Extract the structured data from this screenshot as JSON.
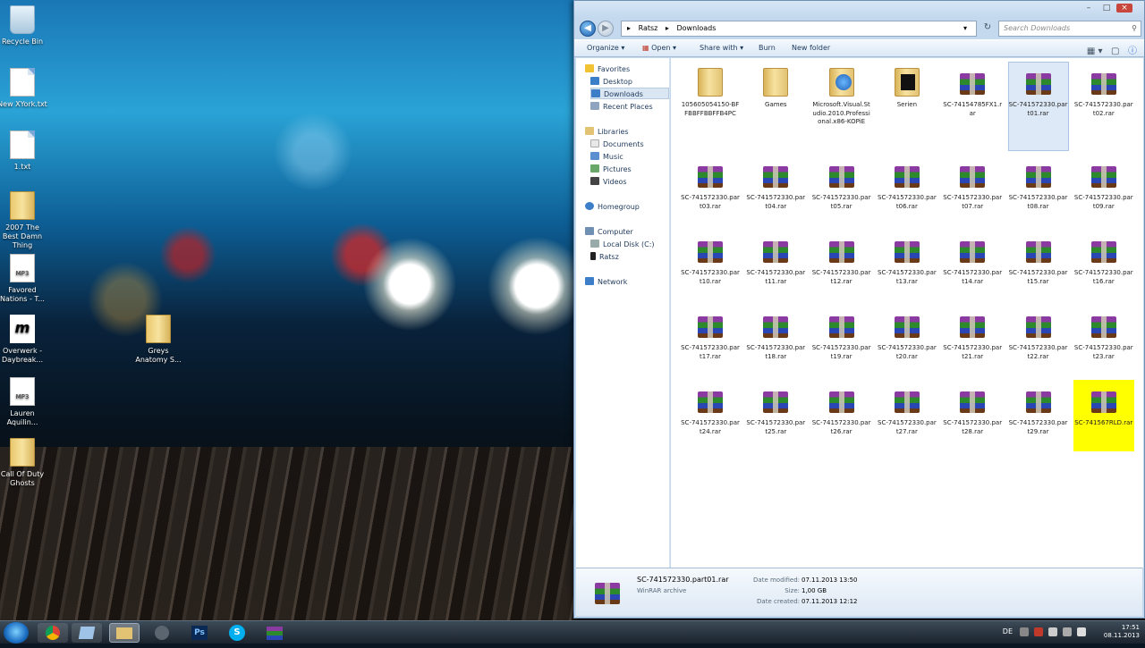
{
  "desktop": {
    "icons": [
      {
        "label": "Recycle Bin",
        "kind": "bin"
      },
      {
        "label": "New XYork.txt",
        "kind": "doc"
      },
      {
        "label": "1.txt",
        "kind": "doc"
      },
      {
        "label": "2007 The Best Damn Thing",
        "kind": "folder"
      },
      {
        "label": "Favored Nations - T...",
        "kind": "mp3"
      },
      {
        "label": "Overwerk - Daybreak...",
        "kind": "app"
      },
      {
        "label": "Lauren Aquilin...",
        "kind": "mp3"
      },
      {
        "label": "Call Of Duty Ghosts",
        "kind": "folder"
      },
      {
        "label": "Greys Anatomy S...",
        "kind": "folder"
      }
    ]
  },
  "explorer": {
    "breadcrumb": [
      "Ratsz",
      "Downloads"
    ],
    "search_placeholder": "Search Downloads",
    "toolbar": {
      "organize": "Organize",
      "open": "Open",
      "share": "Share with",
      "burn": "Burn",
      "new_folder": "New folder"
    },
    "nav": {
      "favorites": "Favorites",
      "desktop": "Desktop",
      "downloads": "Downloads",
      "recent": "Recent Places",
      "libraries": "Libraries",
      "documents": "Documents",
      "music": "Music",
      "pictures": "Pictures",
      "videos": "Videos",
      "homegroup": "Homegroup",
      "computer": "Computer",
      "local_disk": "Local Disk (C:)",
      "ratsz": "Ratsz",
      "network": "Network"
    },
    "files": [
      {
        "name": "105605054150-BFFBBFFBBFFB4PC",
        "type": "folder"
      },
      {
        "name": "Games",
        "type": "folder"
      },
      {
        "name": "Microsoft.Visual.Studio.2010.Professional.x86-KOPiE",
        "type": "folder-vs"
      },
      {
        "name": "Serien",
        "type": "folder-dark"
      },
      {
        "name": "SC-74154785FX1.rar",
        "type": "rar"
      },
      {
        "name": "SC-741572330.part01.rar",
        "type": "rar",
        "state": "selected"
      },
      {
        "name": "SC-741572330.part02.rar",
        "type": "rar"
      },
      {
        "name": "SC-741572330.part03.rar",
        "type": "rar"
      },
      {
        "name": "SC-741572330.part04.rar",
        "type": "rar"
      },
      {
        "name": "SC-741572330.part05.rar",
        "type": "rar"
      },
      {
        "name": "SC-741572330.part06.rar",
        "type": "rar"
      },
      {
        "name": "SC-741572330.part07.rar",
        "type": "rar"
      },
      {
        "name": "SC-741572330.part08.rar",
        "type": "rar"
      },
      {
        "name": "SC-741572330.part09.rar",
        "type": "rar"
      },
      {
        "name": "SC-741572330.part10.rar",
        "type": "rar"
      },
      {
        "name": "SC-741572330.part11.rar",
        "type": "rar"
      },
      {
        "name": "SC-741572330.part12.rar",
        "type": "rar"
      },
      {
        "name": "SC-741572330.part13.rar",
        "type": "rar"
      },
      {
        "name": "SC-741572330.part14.rar",
        "type": "rar"
      },
      {
        "name": "SC-741572330.part15.rar",
        "type": "rar"
      },
      {
        "name": "SC-741572330.part16.rar",
        "type": "rar"
      },
      {
        "name": "SC-741572330.part17.rar",
        "type": "rar"
      },
      {
        "name": "SC-741572330.part18.rar",
        "type": "rar"
      },
      {
        "name": "SC-741572330.part19.rar",
        "type": "rar"
      },
      {
        "name": "SC-741572330.part20.rar",
        "type": "rar"
      },
      {
        "name": "SC-741572330.part21.rar",
        "type": "rar"
      },
      {
        "name": "SC-741572330.part22.rar",
        "type": "rar"
      },
      {
        "name": "SC-741572330.part23.rar",
        "type": "rar"
      },
      {
        "name": "SC-741572330.part24.rar",
        "type": "rar"
      },
      {
        "name": "SC-741572330.part25.rar",
        "type": "rar"
      },
      {
        "name": "SC-741572330.part26.rar",
        "type": "rar"
      },
      {
        "name": "SC-741572330.part27.rar",
        "type": "rar"
      },
      {
        "name": "SC-741572330.part28.rar",
        "type": "rar"
      },
      {
        "name": "SC-741572330.part29.rar",
        "type": "rar"
      },
      {
        "name": "SC-741567RLD.rar",
        "type": "rar",
        "state": "highlighted"
      }
    ],
    "details": {
      "name": "SC-741572330.part01.rar",
      "type": "WinRAR archive",
      "modified_label": "Date modified:",
      "modified": "07.11.2013 13:50",
      "size_label": "Size:",
      "size": "1,00 GB",
      "created_label": "Date created:",
      "created": "07.11.2013 12:12"
    }
  },
  "taskbar": {
    "lang": "DE",
    "time": "17:51",
    "date": "08.11.2013",
    "ps_label": "Ps",
    "skype_label": "S"
  }
}
